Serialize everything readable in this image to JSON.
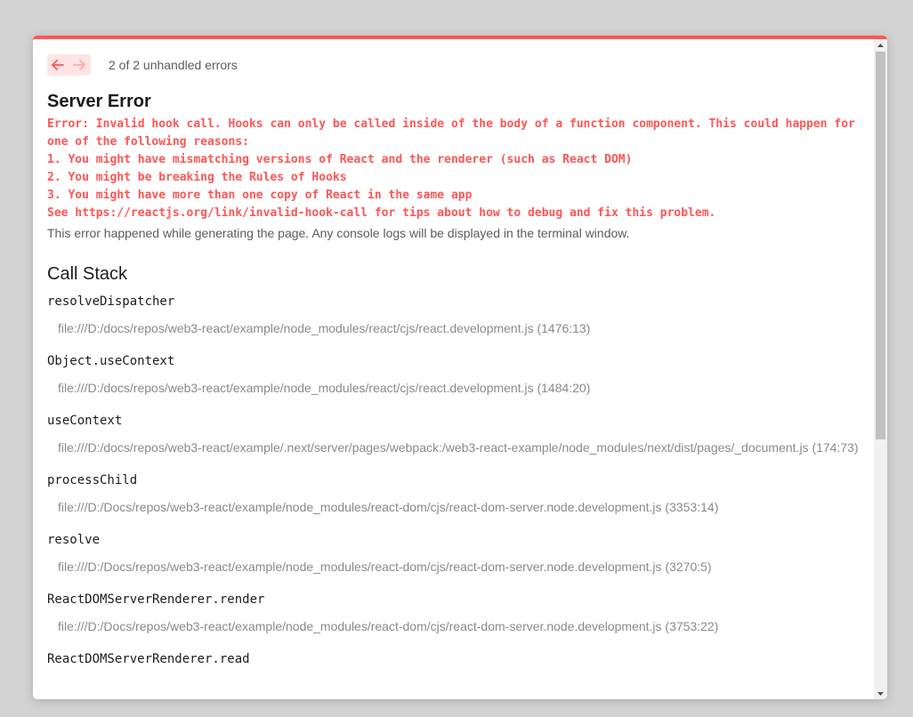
{
  "nav": {
    "prev_icon": "arrow-left-icon",
    "next_icon": "arrow-right-icon",
    "count_label": "2 of 2 unhandled errors"
  },
  "error": {
    "title": "Server Error",
    "message_lines": [
      "Error: Invalid hook call. Hooks can only be called inside of the body of a function component. This could happen for",
      "one of the following reasons:",
      "1. You might have mismatching versions of React and the renderer (such as React DOM)",
      "2. You might be breaking the Rules of Hooks",
      "3. You might have more than one copy of React in the same app",
      "See https://reactjs.org/link/invalid-hook-call for tips about how to debug and fix this problem."
    ],
    "note": "This error happened while generating the page. Any console logs will be displayed in the terminal window."
  },
  "call_stack": {
    "title": "Call Stack",
    "frames": [
      {
        "fn": "resolveDispatcher",
        "loc": "file:///D:/docs/repos/web3-react/example/node_modules/react/cjs/react.development.js (1476:13)"
      },
      {
        "fn": "Object.useContext",
        "loc": "file:///D:/docs/repos/web3-react/example/node_modules/react/cjs/react.development.js (1484:20)"
      },
      {
        "fn": "useContext",
        "loc": "file:///D:/docs/repos/web3-react/example/.next/server/pages/webpack:/web3-react-example/node_modules/next/dist/pages/_document.js (174:73)"
      },
      {
        "fn": "processChild",
        "loc": "file:///D:/Docs/repos/web3-react/example/node_modules/react-dom/cjs/react-dom-server.node.development.js (3353:14)"
      },
      {
        "fn": "resolve",
        "loc": "file:///D:/Docs/repos/web3-react/example/node_modules/react-dom/cjs/react-dom-server.node.development.js (3270:5)"
      },
      {
        "fn": "ReactDOMServerRenderer.render",
        "loc": "file:///D:/Docs/repos/web3-react/example/node_modules/react-dom/cjs/react-dom-server.node.development.js (3753:22)"
      },
      {
        "fn": "ReactDOMServerRenderer.read",
        "loc": ""
      }
    ]
  },
  "colors": {
    "accent": "#ff5555",
    "nav_bg": "#ffe4e4",
    "muted_text": "#8a8a8a"
  }
}
